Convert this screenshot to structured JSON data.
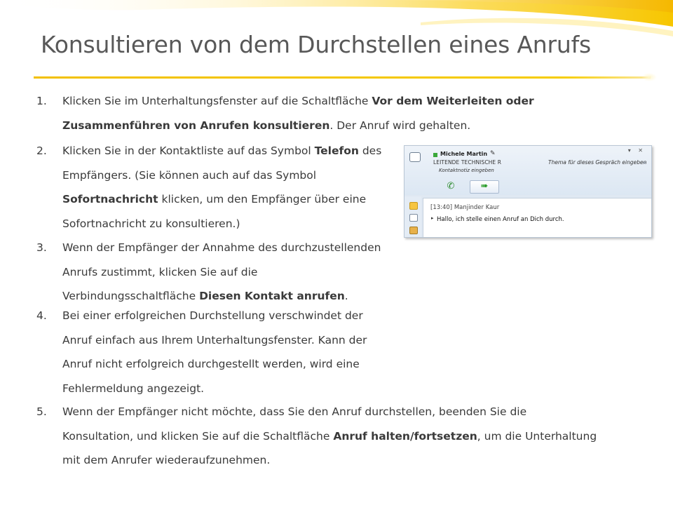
{
  "title": "Konsultieren von dem Durchstellen eines Anrufs",
  "steps": [
    {
      "num": "1.",
      "parts": [
        {
          "t": "Klicken Sie im Unterhaltungsfenster auf die Schaltfläche ",
          "b": false
        },
        {
          "t": "Vor dem Weiterleiten oder Zusammenführen von Anrufen konsultieren",
          "b": true
        },
        {
          "t": ". Der Anruf wird gehalten.",
          "b": false
        }
      ]
    },
    {
      "num": "2.",
      "parts": [
        {
          "t": "Klicken Sie in der Kontaktliste auf das Symbol ",
          "b": false
        },
        {
          "t": "Telefon",
          "b": true
        },
        {
          "t": " des Empfängers. (Sie können auch auf das Symbol ",
          "b": false
        },
        {
          "t": "Sofortnachricht",
          "b": true
        },
        {
          "t": " klicken, um den Empfänger über eine Sofortnachricht zu konsultieren.)",
          "b": false
        }
      ]
    },
    {
      "num": "3.",
      "parts": [
        {
          "t": "Wenn der Empfänger der Annahme des durchzustellenden Anrufs zustimmt, klicken Sie auf die Verbindungsschaltfläche ",
          "b": false
        },
        {
          "t": "Diesen Kontakt anrufen",
          "b": true
        },
        {
          "t": ".",
          "b": false
        }
      ]
    },
    {
      "num": "4.",
      "parts": [
        {
          "t": "Bei einer erfolgreichen Durchstellung verschwindet der Anruf einfach aus Ihrem Unterhaltungsfenster. Kann der Anruf nicht erfolgreich durchgestellt werden, wird eine Fehlermeldung angezeigt.",
          "b": false
        }
      ]
    },
    {
      "num": "5.",
      "parts": [
        {
          "t": "Wenn der Empfänger nicht möchte, dass Sie den Anruf durchstellen, beenden Sie die Konsultation, und klicken Sie auf die Schaltfläche ",
          "b": false
        },
        {
          "t": "Anruf halten/fortsetzen",
          "b": true
        },
        {
          "t": ", um die Unterhaltung mit dem Anrufer wiederaufzunehmen.",
          "b": false
        }
      ]
    }
  ],
  "screenshot": {
    "contact_name": "Michele Martin",
    "department": "LEITENDE TECHNISCHE R",
    "contact_note": "Kontaktnotiz eingeben",
    "topic_placeholder": "Thema für dieses Gespräch eingeben",
    "sender_line": "[13:40] Manjinder Kaur",
    "message": "Hallo, ich stelle einen Anruf an Dich durch.",
    "window_controls": "▾ ✕",
    "icons": [
      "chat-icon",
      "phone-icon",
      "consult-arrow-icon",
      "note-icon",
      "sidebar-icons"
    ]
  },
  "colors": {
    "accent_yellow": "#f6cc00",
    "title_gray": "#585858"
  }
}
